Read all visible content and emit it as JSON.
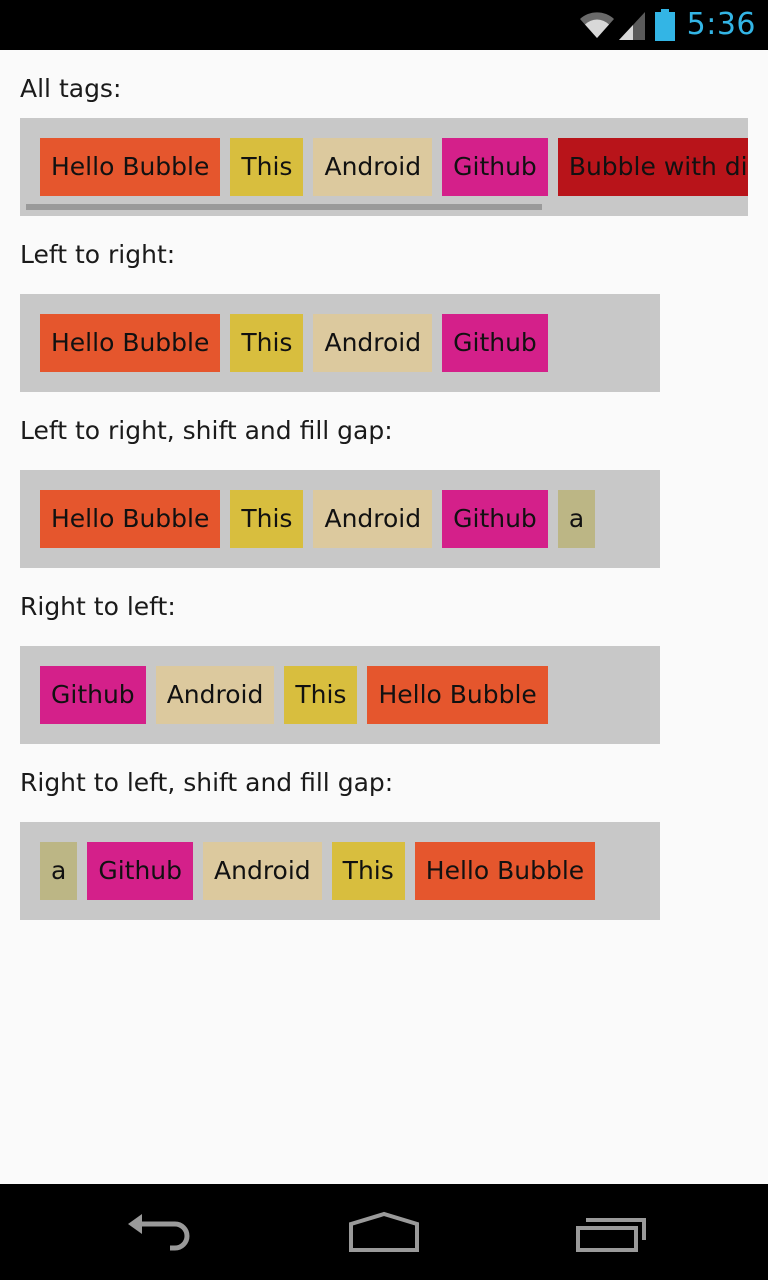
{
  "status_bar": {
    "time": "5:36",
    "icons": [
      "wifi-icon",
      "cell-signal-icon",
      "battery-icon"
    ],
    "accent_color": "#33b5e5"
  },
  "sections": [
    {
      "label": "All tags:",
      "tags": [
        {
          "text": "Hello Bubble",
          "color": "#e5562d"
        },
        {
          "text": "This",
          "color": "#d8be3e"
        },
        {
          "text": "Android",
          "color": "#dcc99e"
        },
        {
          "text": "Github",
          "color": "#d4208a"
        },
        {
          "text": "Bubble with different color",
          "color": "#b8141a"
        }
      ]
    },
    {
      "label": "Left to right:",
      "tags": [
        {
          "text": "Hello Bubble",
          "color": "#e5562d"
        },
        {
          "text": "This",
          "color": "#d8be3e"
        },
        {
          "text": "Android",
          "color": "#dcc99e"
        },
        {
          "text": "Github",
          "color": "#d4208a"
        }
      ]
    },
    {
      "label": "Left to right, shift and fill gap:",
      "tags": [
        {
          "text": "Hello Bubble",
          "color": "#e5562d"
        },
        {
          "text": "This",
          "color": "#d8be3e"
        },
        {
          "text": "Android",
          "color": "#dcc99e"
        },
        {
          "text": "Github",
          "color": "#d4208a"
        },
        {
          "text": "a",
          "color": "#bcb685"
        }
      ]
    },
    {
      "label": "Right to left:",
      "tags": [
        {
          "text": "Github",
          "color": "#d4208a"
        },
        {
          "text": "Android",
          "color": "#dcc99e"
        },
        {
          "text": "This",
          "color": "#d8be3e"
        },
        {
          "text": "Hello Bubble",
          "color": "#e5562d"
        }
      ]
    },
    {
      "label": "Right to left, shift and fill gap:",
      "tags": [
        {
          "text": "a",
          "color": "#bcb685"
        },
        {
          "text": "Github",
          "color": "#d4208a"
        },
        {
          "text": "Android",
          "color": "#dcc99e"
        },
        {
          "text": "This",
          "color": "#d8be3e"
        },
        {
          "text": "Hello Bubble",
          "color": "#e5562d"
        }
      ]
    }
  ],
  "nav_bar": {
    "buttons": [
      "back-icon",
      "home-icon",
      "recent-apps-icon"
    ]
  }
}
